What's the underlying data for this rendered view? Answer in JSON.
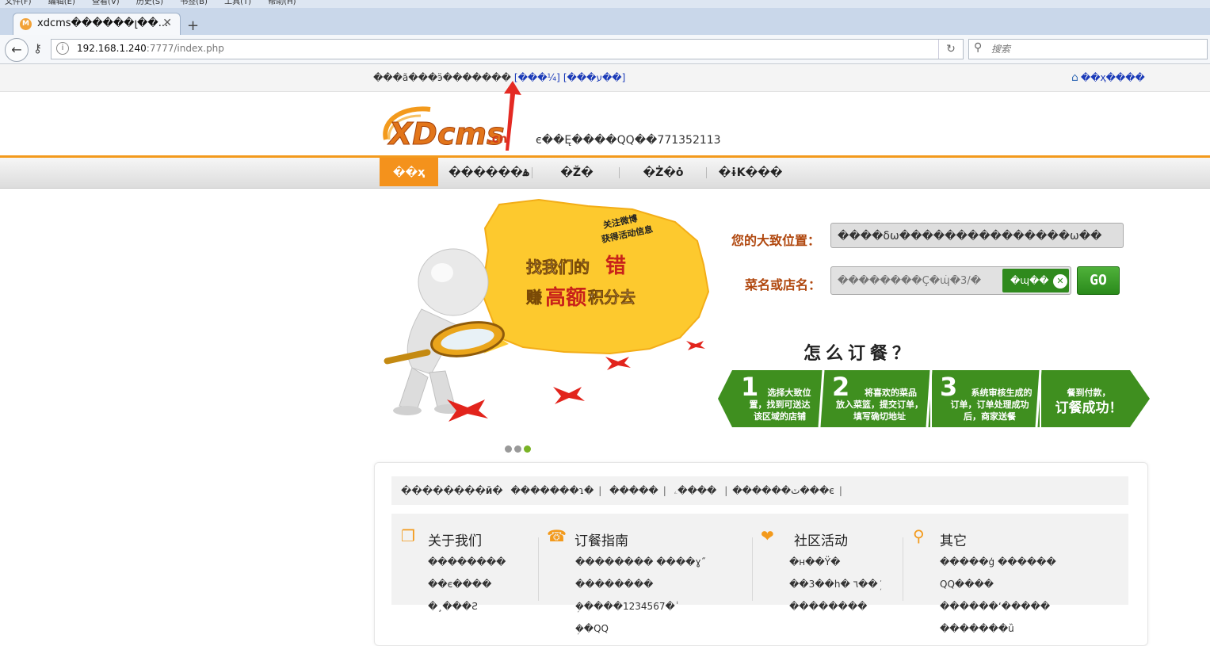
{
  "browser": {
    "menu_items": [
      "文件(F)",
      "编辑(E)",
      "查看(V)",
      "历史(S)",
      "书签(B)",
      "工具(T)",
      "帮助(H)"
    ],
    "tab_title": "xdcms������լ��...",
    "url_host": "192.168.1.240",
    "url_rest": ":7777/index.php",
    "search_placeholder": "搜索"
  },
  "topbar": {
    "welcome": "���ã���ӭ�������",
    "login_link": "[���¼]",
    "register_link": "[���ע��]",
    "home_link": "��ҳ����"
  },
  "header": {
    "logo_text": "XDcms",
    "logo_suffix": ".cn",
    "hotline": "є��Ę����QQ��771352113"
  },
  "nav": {
    "items": [
      "��ҳ",
      "������ۿ",
      "�Ž�",
      "�Ż�ȯ",
      "�ɨK���"
    ]
  },
  "banner": {
    "bubble_small_1": "关注微博",
    "bubble_small_2": "获得活动信息",
    "bubble_line_1a": "找我们的",
    "bubble_line_1b": "错",
    "bubble_line_2a": "赚",
    "bubble_line_2b": "高额",
    "bubble_line_2c": "积分去"
  },
  "search": {
    "location_label": "您的大致位置：",
    "location_value": "����δѡ���������������ѡ��",
    "dish_label": "菜名或店名：",
    "dish_placeholder": "��������Ç�ɰ͡�3/�",
    "dish_tip": "�ɰ��",
    "go_label": "GO"
  },
  "howto": {
    "title": "怎么订餐？",
    "steps": [
      {
        "num": "1",
        "text": [
          "选择大致位",
          "置，找到可送达",
          "该区域的店铺"
        ]
      },
      {
        "num": "2",
        "text": [
          "将喜欢的菜品",
          "放入菜篮，提交订单，",
          "填写确切地址"
        ]
      },
      {
        "num": "3",
        "text": [
          "系统审核生成的",
          "订单，订单处理成功",
          "后，商家送餐"
        ]
      },
      {
        "num": "",
        "text": [
          "餐到付款，",
          "订餐成功！"
        ]
      }
    ]
  },
  "footer": {
    "links_title": "��������ӣ�",
    "links": [
      "�������ɿ�",
      "�����",
      "ٽ������",
      "����ۦ���є"
    ],
    "columns": [
      {
        "title": "关于我们",
        "icon": "info-icon",
        "lines": [
          "��������",
          "��є����",
          "�¸���Ƨ"
        ]
      },
      {
        "title": "订餐指南",
        "icon": "phone-icon",
        "lines": [
          "��������    ����ɣ˝",
          "��������",
          "�ܲ����1234567�ٰ",
          "�ܲ�QQ"
        ]
      },
      {
        "title": "社区活动",
        "icon": "heart-hand-icon",
        "lines": [
          "�н��Ÿ�",
          "��3��h�    ٦��ܲ",
          "��������"
        ]
      },
      {
        "title": "其它",
        "icon": "search-icon",
        "lines": [
          "�����ģ    ������",
          "QQ����",
          "������ʻ�����",
          "�������ȕ"
        ]
      }
    ]
  },
  "colors": {
    "accent_orange": "#f4921c",
    "step_green": "#3f8f1f",
    "label_brown": "#b0470e",
    "link_blue": "#1a3ab8"
  }
}
